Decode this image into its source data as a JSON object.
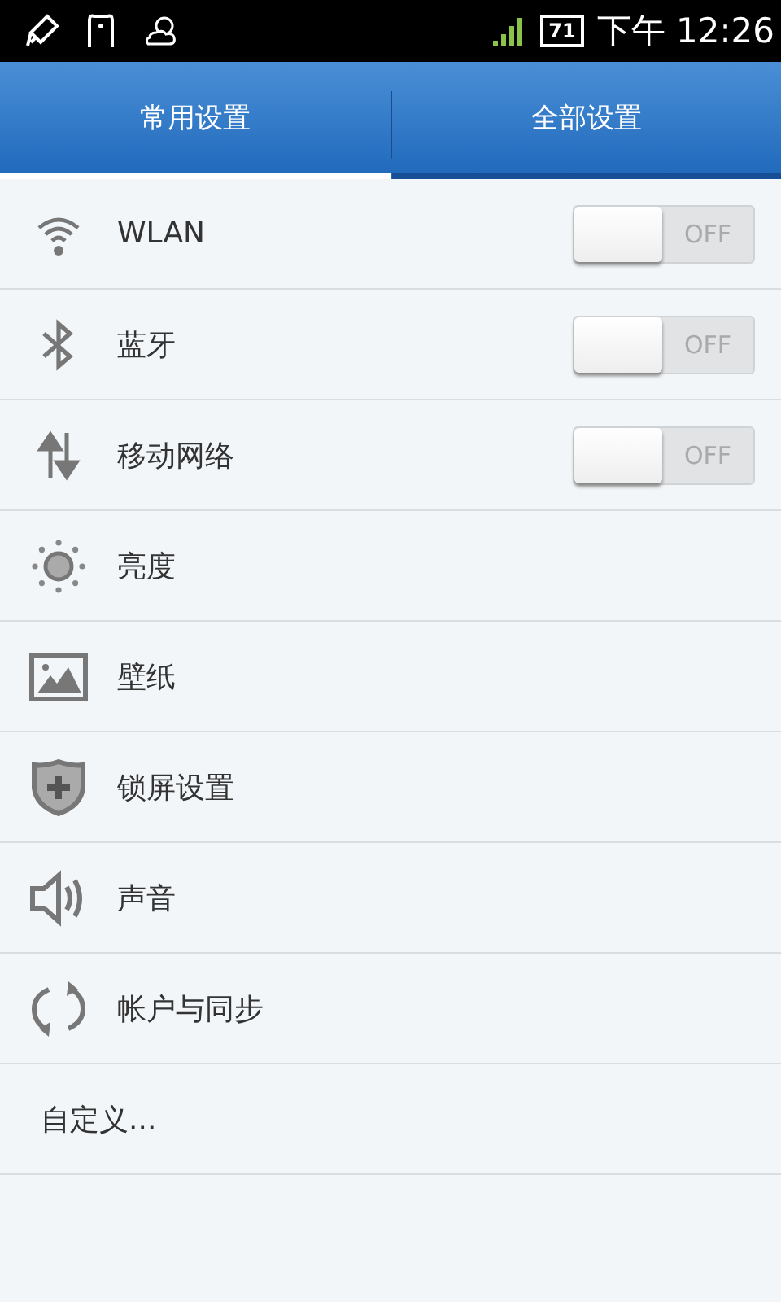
{
  "status_bar": {
    "battery": "71",
    "time": "下午 12:26"
  },
  "tabs": [
    {
      "label": "常用设置",
      "selected": true
    },
    {
      "label": "全部设置",
      "selected": false
    }
  ],
  "items": [
    {
      "kind": "toggle",
      "label": "WLAN",
      "on": false,
      "switch_text": "OFF"
    },
    {
      "kind": "toggle",
      "label": "蓝牙",
      "on": false,
      "switch_text": "OFF"
    },
    {
      "kind": "toggle",
      "label": "移动网络",
      "on": false,
      "switch_text": "OFF"
    },
    {
      "kind": "link",
      "label": "亮度"
    },
    {
      "kind": "link",
      "label": "壁纸"
    },
    {
      "kind": "link",
      "label": "锁屏设置"
    },
    {
      "kind": "link",
      "label": "声音"
    },
    {
      "kind": "link",
      "label": "帐户与同步"
    },
    {
      "kind": "text",
      "label": "自定义..."
    }
  ]
}
